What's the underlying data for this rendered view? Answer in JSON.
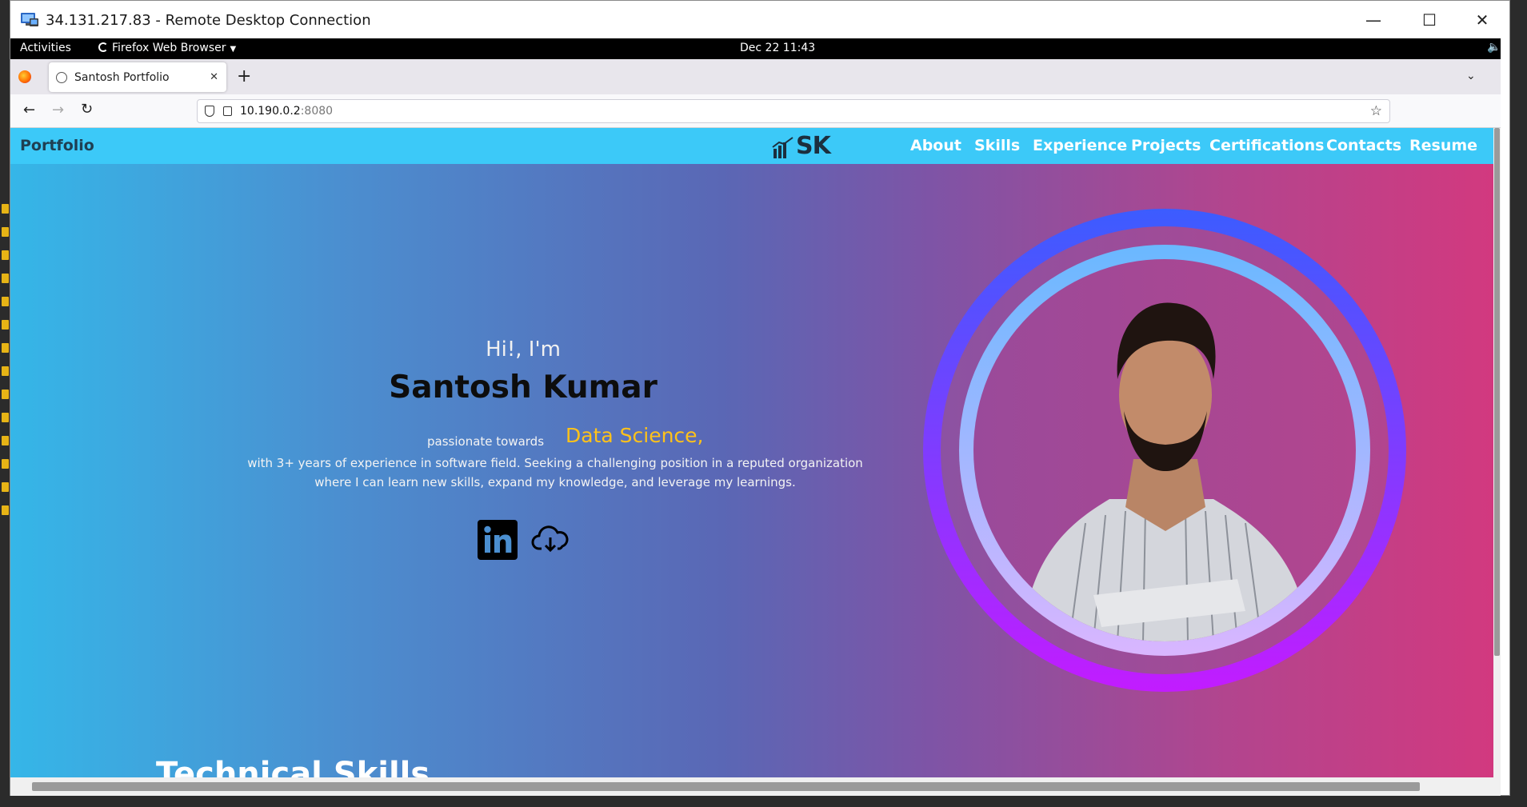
{
  "window": {
    "title": "34.131.217.83 - Remote Desktop Connection",
    "minimize": "—",
    "maximize": "☐",
    "close": "✕"
  },
  "gnome": {
    "activities": "Activities",
    "app": "Firefox Web Browser",
    "clock": "Dec 22  11:43"
  },
  "browser": {
    "tab_title": "Santosh Portfolio",
    "tab_close": "✕",
    "new_tab": "+",
    "url_host": "10.190.0.2",
    "url_port": ":8080"
  },
  "site": {
    "brand": "Portfolio",
    "logo_text": "SK",
    "nav": [
      "About",
      "Skills",
      "Experience",
      "Projects",
      "Certifications",
      "Contacts",
      "Resume"
    ],
    "greeting": "Hi!, I'm",
    "name": "Santosh Kumar",
    "passion": "passionate towards",
    "highlight": "Data Science,",
    "description": "with 3+ years of experience in software field. Seeking a challenging position in a reputed organization where I can learn new skills, expand my knowledge, and leverage my learnings.",
    "section_heading": "Technical Skills",
    "colors": {
      "navbar": "#3cc9f8",
      "highlight": "#ffc21a",
      "ring_outer_top": "#3c5cff",
      "ring_outer_bottom": "#c21cff"
    }
  }
}
